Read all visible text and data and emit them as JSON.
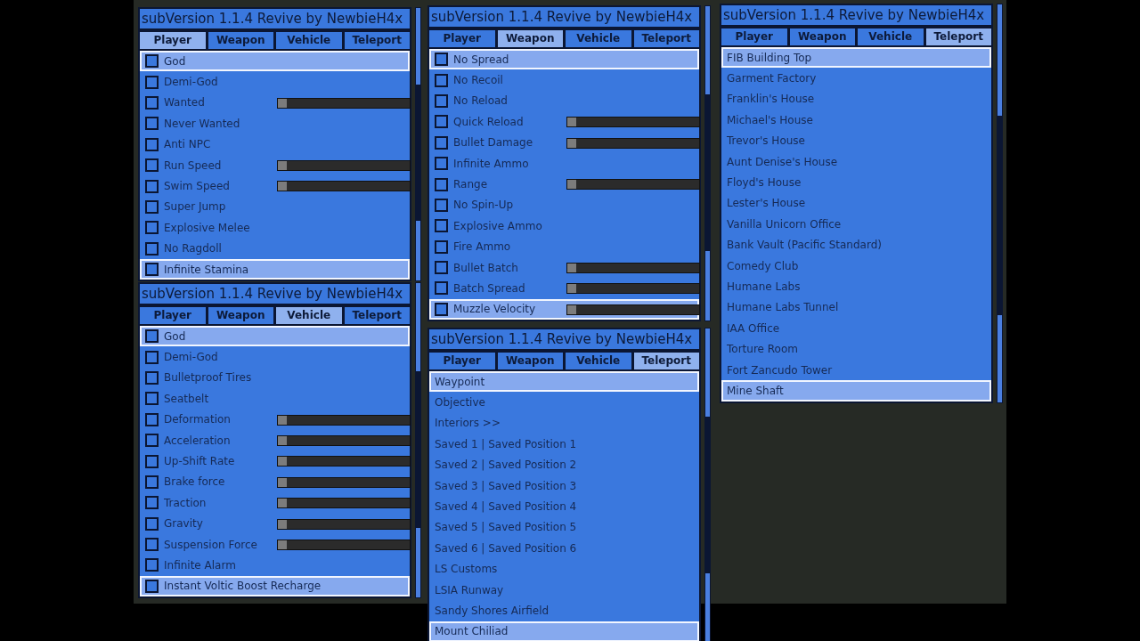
{
  "panels": [
    {
      "title": "subVersion 1.1.4 Revive by NewbieH4x",
      "tabs": [
        {
          "label": "Player",
          "selected": true
        },
        {
          "label": "Weapon",
          "selected": false
        },
        {
          "label": "Vehicle",
          "selected": false
        },
        {
          "label": "Teleport",
          "selected": false
        }
      ],
      "items": [
        {
          "kind": "toggle",
          "label": "God",
          "selected": true,
          "checked": false
        },
        {
          "kind": "toggle",
          "label": "Demi-God",
          "selected": false,
          "checked": false
        },
        {
          "kind": "slider",
          "label": "Wanted",
          "selected": false,
          "checked": false,
          "level": 0
        },
        {
          "kind": "toggle",
          "label": "Never Wanted",
          "selected": false,
          "checked": false
        },
        {
          "kind": "toggle",
          "label": "Anti NPC",
          "selected": false,
          "checked": false
        },
        {
          "kind": "slider",
          "label": "Run Speed",
          "selected": false,
          "checked": false,
          "level": 0
        },
        {
          "kind": "slider",
          "label": "Swim Speed",
          "selected": false,
          "checked": false,
          "level": 0
        },
        {
          "kind": "toggle",
          "label": "Super Jump",
          "selected": false,
          "checked": false
        },
        {
          "kind": "toggle",
          "label": "Explosive Melee",
          "selected": false,
          "checked": false
        },
        {
          "kind": "toggle",
          "label": "No Ragdoll",
          "selected": false,
          "checked": false
        },
        {
          "kind": "toggle",
          "label": "Infinite Stamina",
          "selected": true,
          "checked": false
        }
      ]
    },
    {
      "title": "subVersion 1.1.4 Revive by NewbieH4x",
      "tabs": [
        {
          "label": "Player",
          "selected": false
        },
        {
          "label": "Weapon",
          "selected": false
        },
        {
          "label": "Vehicle",
          "selected": true
        },
        {
          "label": "Teleport",
          "selected": false
        }
      ],
      "items": [
        {
          "kind": "toggle",
          "label": "God",
          "selected": true,
          "checked": false
        },
        {
          "kind": "toggle",
          "label": "Demi-God",
          "selected": false,
          "checked": false
        },
        {
          "kind": "toggle",
          "label": "Bulletproof Tires",
          "selected": false,
          "checked": false
        },
        {
          "kind": "toggle",
          "label": "Seatbelt",
          "selected": false,
          "checked": false
        },
        {
          "kind": "slider",
          "label": "Deformation",
          "selected": false,
          "checked": false,
          "level": 0
        },
        {
          "kind": "slider",
          "label": "Acceleration",
          "selected": false,
          "checked": false,
          "level": 0
        },
        {
          "kind": "slider",
          "label": "Up-Shift Rate",
          "selected": false,
          "checked": false,
          "level": 0
        },
        {
          "kind": "slider",
          "label": "Brake force",
          "selected": false,
          "checked": false,
          "level": 0
        },
        {
          "kind": "slider",
          "label": "Traction",
          "selected": false,
          "checked": false,
          "level": 0
        },
        {
          "kind": "slider",
          "label": "Gravity",
          "selected": false,
          "checked": false,
          "level": 0
        },
        {
          "kind": "slider",
          "label": "Suspension Force",
          "selected": false,
          "checked": false,
          "level": 0
        },
        {
          "kind": "toggle",
          "label": "Infinite Alarm",
          "selected": false,
          "checked": false
        },
        {
          "kind": "toggle",
          "label": "Instant Voltic Boost Recharge",
          "selected": true,
          "checked": false
        }
      ]
    },
    {
      "title": "subVersion 1.1.4 Revive by NewbieH4x",
      "tabs": [
        {
          "label": "Player",
          "selected": false
        },
        {
          "label": "Weapon",
          "selected": true
        },
        {
          "label": "Vehicle",
          "selected": false
        },
        {
          "label": "Teleport",
          "selected": false
        }
      ],
      "items": [
        {
          "kind": "toggle",
          "label": "No Spread",
          "selected": true,
          "checked": false
        },
        {
          "kind": "toggle",
          "label": "No Recoil",
          "selected": false,
          "checked": false
        },
        {
          "kind": "toggle",
          "label": "No Reload",
          "selected": false,
          "checked": false
        },
        {
          "kind": "slider",
          "label": "Quick Reload",
          "selected": false,
          "checked": false,
          "level": 0
        },
        {
          "kind": "slider",
          "label": "Bullet Damage",
          "selected": false,
          "checked": false,
          "level": 0
        },
        {
          "kind": "toggle",
          "label": "Infinite Ammo",
          "selected": false,
          "checked": false
        },
        {
          "kind": "slider",
          "label": "Range",
          "selected": false,
          "checked": false,
          "level": 0
        },
        {
          "kind": "toggle",
          "label": "No Spin-Up",
          "selected": false,
          "checked": false
        },
        {
          "kind": "toggle",
          "label": "Explosive Ammo",
          "selected": false,
          "checked": false
        },
        {
          "kind": "toggle",
          "label": "Fire Ammo",
          "selected": false,
          "checked": false
        },
        {
          "kind": "slider",
          "label": "Bullet Batch",
          "selected": false,
          "checked": false,
          "level": 0
        },
        {
          "kind": "slider",
          "label": "Batch Spread",
          "selected": false,
          "checked": false,
          "level": 0
        },
        {
          "kind": "slider",
          "label": "Muzzle Velocity",
          "selected": true,
          "checked": false,
          "level": 0
        }
      ]
    },
    {
      "title": "subVersion 1.1.4 Revive by NewbieH4x",
      "tabs": [
        {
          "label": "Player",
          "selected": false
        },
        {
          "label": "Weapon",
          "selected": false
        },
        {
          "label": "Vehicle",
          "selected": false
        },
        {
          "label": "Teleport",
          "selected": true
        }
      ],
      "items": [
        {
          "kind": "link",
          "label": "Waypoint",
          "selected": true
        },
        {
          "kind": "link",
          "label": "Objective",
          "selected": false
        },
        {
          "kind": "link",
          "label": "Interiors >>",
          "selected": false
        },
        {
          "kind": "link",
          "label": "Saved 1 | Saved Position 1",
          "selected": false
        },
        {
          "kind": "link",
          "label": "Saved 2 | Saved Position 2",
          "selected": false
        },
        {
          "kind": "link",
          "label": "Saved 3 | Saved Position 3",
          "selected": false
        },
        {
          "kind": "link",
          "label": "Saved 4 | Saved Position 4",
          "selected": false
        },
        {
          "kind": "link",
          "label": "Saved 5 | Saved Position 5",
          "selected": false
        },
        {
          "kind": "link",
          "label": "Saved 6 | Saved Position 6",
          "selected": false
        },
        {
          "kind": "link",
          "label": "LS Customs",
          "selected": false
        },
        {
          "kind": "link",
          "label": "LSIA Runway",
          "selected": false
        },
        {
          "kind": "link",
          "label": "Sandy Shores Airfield",
          "selected": false
        },
        {
          "kind": "link",
          "label": "Mount Chiliad",
          "selected": true
        }
      ]
    },
    {
      "title": "subVersion 1.1.4 Revive by NewbieH4x",
      "tabs": [
        {
          "label": "Player",
          "selected": false
        },
        {
          "label": "Weapon",
          "selected": false
        },
        {
          "label": "Vehicle",
          "selected": false
        },
        {
          "label": "Teleport",
          "selected": true
        }
      ],
      "items": [
        {
          "kind": "link",
          "label": "FIB Building Top",
          "selected": true
        },
        {
          "kind": "link",
          "label": "Garment Factory",
          "selected": false
        },
        {
          "kind": "link",
          "label": "Franklin's House",
          "selected": false
        },
        {
          "kind": "link",
          "label": "Michael's House",
          "selected": false
        },
        {
          "kind": "link",
          "label": "Trevor's House",
          "selected": false
        },
        {
          "kind": "link",
          "label": "Aunt Denise's House",
          "selected": false
        },
        {
          "kind": "link",
          "label": "Floyd's House",
          "selected": false
        },
        {
          "kind": "link",
          "label": "Lester's House",
          "selected": false
        },
        {
          "kind": "link",
          "label": "Vanilla Unicorn Office",
          "selected": false
        },
        {
          "kind": "link",
          "label": "Bank Vault (Pacific Standard)",
          "selected": false
        },
        {
          "kind": "link",
          "label": "Comedy Club",
          "selected": false
        },
        {
          "kind": "link",
          "label": "Humane Labs",
          "selected": false
        },
        {
          "kind": "link",
          "label": "Humane Labs Tunnel",
          "selected": false
        },
        {
          "kind": "link",
          "label": "IAA Office",
          "selected": false
        },
        {
          "kind": "link",
          "label": "Torture Room",
          "selected": false
        },
        {
          "kind": "link",
          "label": "Fort Zancudo Tower",
          "selected": false
        },
        {
          "kind": "link",
          "label": "Mine Shaft",
          "selected": true
        }
      ]
    }
  ]
}
